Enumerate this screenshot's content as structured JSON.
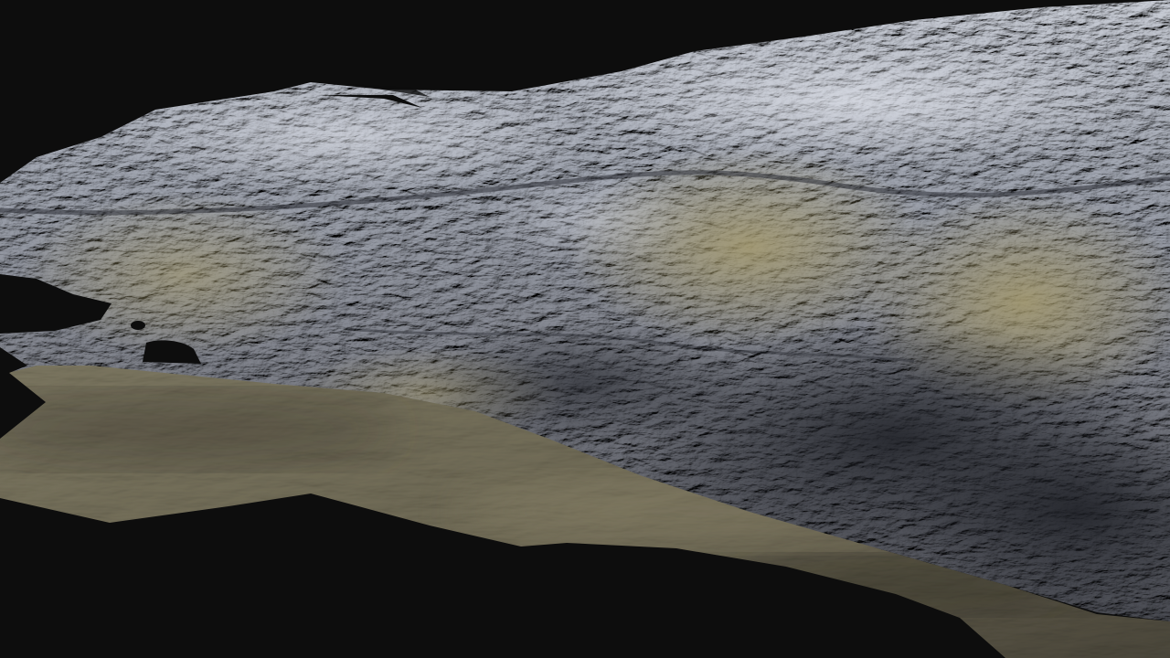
{
  "scene": {
    "subject": "cave-rock-3d-mesh",
    "colors": {
      "background": "#0d0d0d",
      "rock_light": "#b9bec8",
      "rock_mid": "#7e8390",
      "rock_dark": "#3c3f47",
      "ochre": "#8f8868",
      "floor": "#6f6a55",
      "floor_dark": "#3e3b31"
    }
  }
}
